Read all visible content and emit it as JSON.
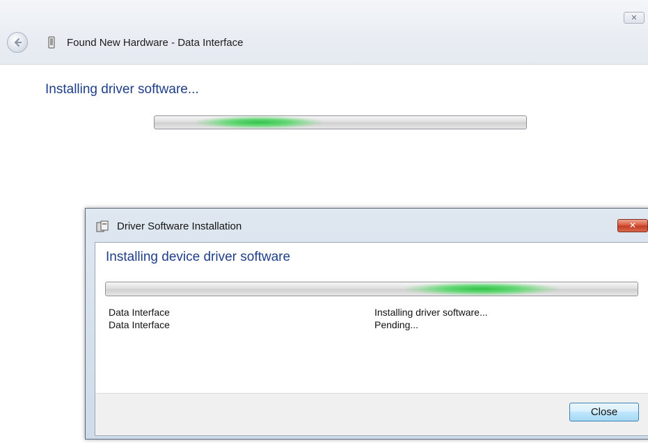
{
  "outer_window": {
    "title": "Found New Hardware - Data Interface",
    "heading": "Installing driver software...",
    "close_glyph": "✕",
    "back_icon": "back-arrow-icon",
    "title_icon": "usb-device-icon",
    "progress_style": "marquee"
  },
  "dialog": {
    "title": "Driver Software Installation",
    "title_icon": "driver-package-icon",
    "close_glyph": "✕",
    "heading": "Installing device driver software",
    "progress_style": "marquee",
    "devices": [
      {
        "name": "Data Interface",
        "status": "Installing driver software..."
      },
      {
        "name": "Data Interface",
        "status": "Pending..."
      }
    ],
    "close_button_label": "Close"
  },
  "colors": {
    "heading_blue": "#1f3e8a",
    "progress_green": "#33c24a",
    "close_red": "#c13a22"
  }
}
